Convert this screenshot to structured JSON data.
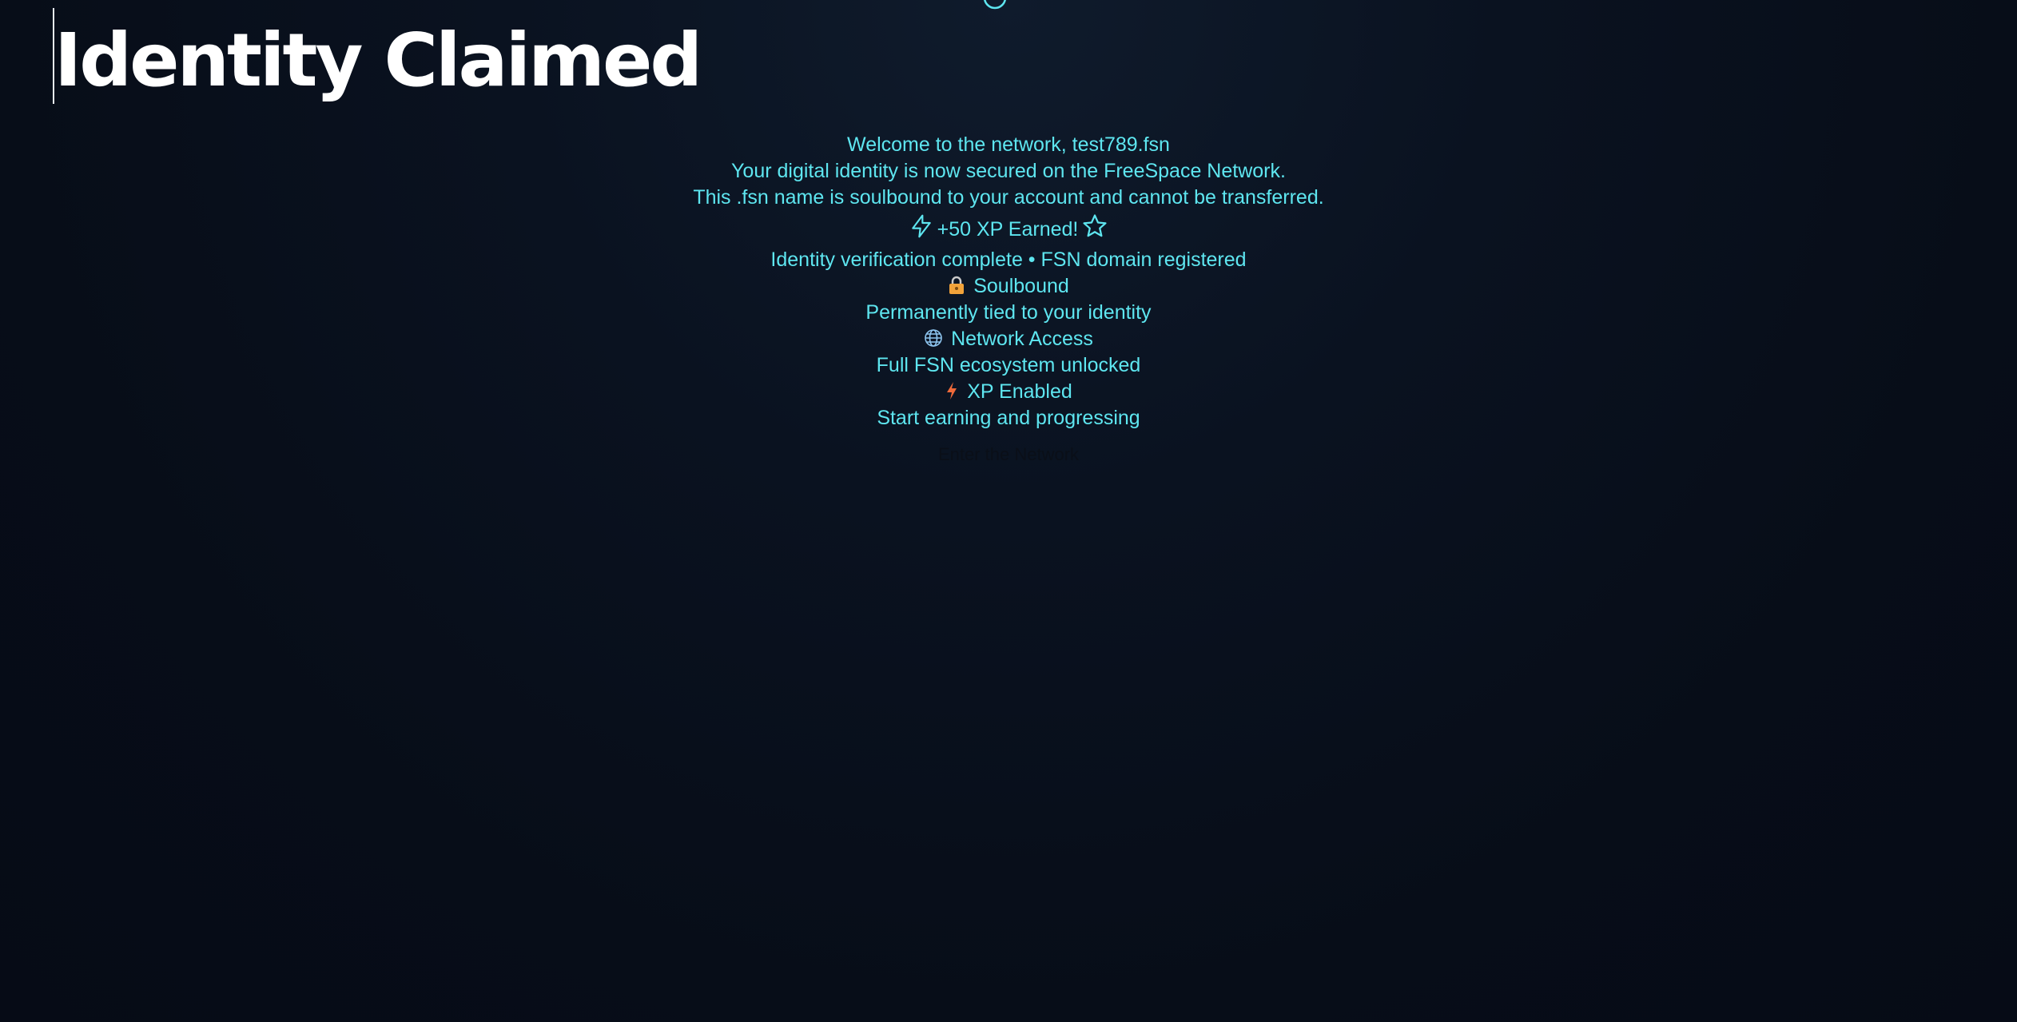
{
  "title": "Identity Claimed",
  "welcome": "Welcome to the network, test789.fsn",
  "secured": "Your digital identity is now secured on the FreeSpace Network.",
  "soulbound_note": "This .fsn name is soulbound to your account and cannot be transferred.",
  "xp_earned": "+50 XP Earned!",
  "verification": "Identity verification complete • FSN domain registered",
  "features": [
    {
      "icon": "lock-icon",
      "title": "Soulbound",
      "desc": "Permanently tied to your identity"
    },
    {
      "icon": "globe-icon",
      "title": "Network Access",
      "desc": "Full FSN ecosystem unlocked"
    },
    {
      "icon": "lightning-icon",
      "title": "XP Enabled",
      "desc": "Start earning and progressing"
    }
  ],
  "enter_button": "Enter the Network",
  "colors": {
    "accent": "#5ee6f0",
    "title": "#ffffff",
    "lock": "#f2a33a",
    "bolt": "#f06a3a",
    "globe": "#8ec5f0"
  }
}
